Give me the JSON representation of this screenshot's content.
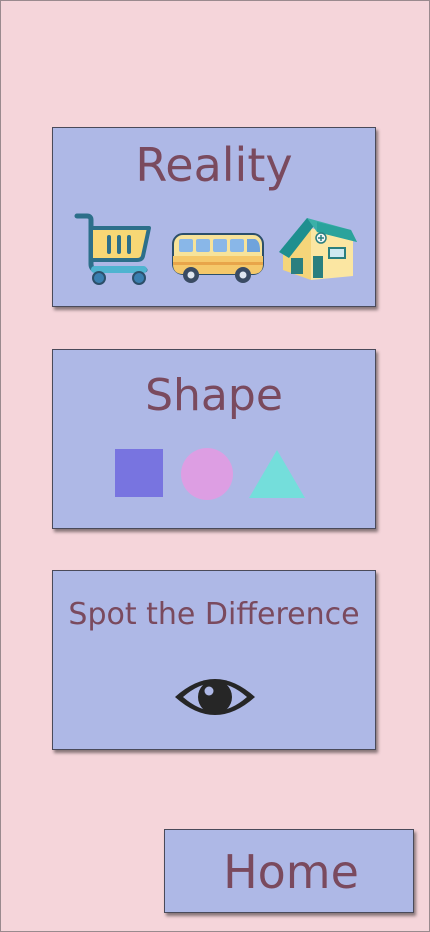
{
  "menu": {
    "reality": {
      "label": "Reality",
      "icons": [
        "shopping-cart-icon",
        "bus-icon",
        "house-icon"
      ]
    },
    "shape": {
      "label": "Shape",
      "icons": [
        "square-icon",
        "circle-icon",
        "triangle-icon"
      ],
      "colors": {
        "square": "#7874e0",
        "circle": "#dd9ee3",
        "triangle": "#74dedb"
      }
    },
    "spot": {
      "label": "Spot the Difference",
      "icons": [
        "eye-icon"
      ]
    }
  },
  "home": {
    "label": "Home"
  },
  "colors": {
    "background": "#f5d5da",
    "card": "#aeb8e6",
    "text": "#7a4a5e"
  }
}
